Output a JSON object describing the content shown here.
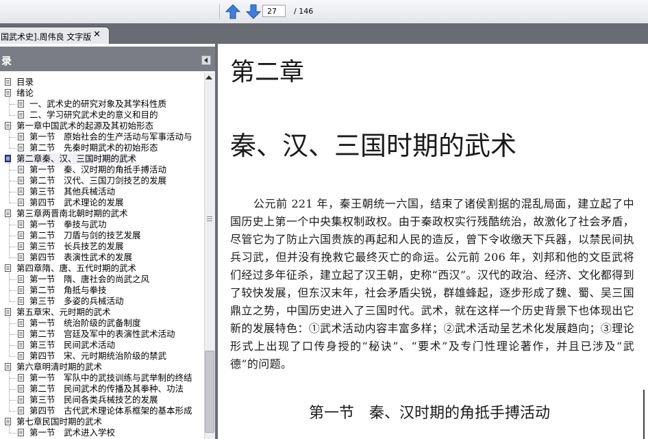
{
  "toolbar": {
    "prev_icon": "arrow-up-icon",
    "next_icon": "arrow-down-icon",
    "page_value": "27",
    "page_total": "/ 146"
  },
  "tab": {
    "label": "国武术史].周伟良 文字版",
    "close": "✕"
  },
  "sidebar": {
    "title": "录",
    "items": [
      {
        "label": "目录",
        "level": 0
      },
      {
        "label": "绪论",
        "level": 0
      },
      {
        "label": "一、武术史的研究对象及其学科性质",
        "level": 1
      },
      {
        "label": "二、学习研究武术史的意义和目的",
        "level": 1
      },
      {
        "label": "第一章中国武术的起源及其初始形态",
        "level": 0
      },
      {
        "label": "第一节　原始社会的生产活动与军事活动与",
        "level": 1
      },
      {
        "label": "第二节　先秦时期武术的初始形态",
        "level": 1
      },
      {
        "label": "第二章秦、汉、三国时期的武术",
        "level": 0,
        "active": true
      },
      {
        "label": "第一节　秦、汉时期的角抵手搏活动",
        "level": 1
      },
      {
        "label": "第二节　汉代、三国刀剑技艺的发展",
        "level": 1
      },
      {
        "label": "第三节　其他兵械活动",
        "level": 1
      },
      {
        "label": "第四节　武术理论的发展",
        "level": 1
      },
      {
        "label": "第三章两晋南北朝时期的武术",
        "level": 0
      },
      {
        "label": "第一节　拳技与武功",
        "level": 1
      },
      {
        "label": "第二节　刀盾与剑的技艺发展",
        "level": 1
      },
      {
        "label": "第三节　长兵技艺的发展",
        "level": 1
      },
      {
        "label": "第四节　表演性武术的发展",
        "level": 1
      },
      {
        "label": "第四章隋、唐、五代时期的武术",
        "level": 0
      },
      {
        "label": "第一节　隋、唐社会的尚武之风",
        "level": 1
      },
      {
        "label": "第二节　角抵与拳技",
        "level": 1
      },
      {
        "label": "第三节　多姿的兵械活动",
        "level": 1
      },
      {
        "label": "第五章宋、元时期的武术",
        "level": 0
      },
      {
        "label": "第一节　统治阶级的武备制度",
        "level": 1
      },
      {
        "label": "第二节　宫廷及军中的表演性武术活动",
        "level": 1
      },
      {
        "label": "第三节　民间武术活动",
        "level": 1
      },
      {
        "label": "第四节　宋、元时期统治阶级的禁武",
        "level": 1
      },
      {
        "label": "第六章明清时期的武术",
        "level": 0
      },
      {
        "label": "第一节　军队中的武技训练与武举制的终结",
        "level": 1
      },
      {
        "label": "第二节　民间武术的传播及其拳种、功法",
        "level": 1
      },
      {
        "label": "第三节　民间各类兵械技艺的发展",
        "level": 1
      },
      {
        "label": "第四节　古代武术理论体系框架的基本形成",
        "level": 1
      },
      {
        "label": "第七章民国时期的武术",
        "level": 0
      },
      {
        "label": "第一节　武术进入学校",
        "level": 1
      }
    ]
  },
  "document": {
    "chapter": "第二章",
    "chapter_title": "秦、汉、三国时期的武术",
    "paragraph": "公元前 221 年，秦王朝统一六国，结束了诸侯割据的混乱局面，建立起了中国历史上第一个中央集权制政权。由于秦政权实行残酷统治，故激化了社会矛盾，尽管它为了防止六国贵族的再起和人民的造反，曾下令收缴天下兵器，以禁民间执兵习武，但并没有挽救它最终灭亡的命运。公元前 206 年，刘邦和他的文臣武将们经过多年征杀，建立起了汉王朝，史称“西汉”。汉代的政治、经济、文化都得到了较快发展，但东汉末年，社会矛盾尖锐，群雄蜂起，逐步形成了魏、蜀、吴三国鼎立之势，中国历史进入了三国时代。武术，就在这样一个历史背景下也体现出它新的发展特色：①武术活动内容丰富多样；②武术活动呈艺术化发展趋向；③理论形式上出现了口传身授的“秘诀”、“要术”及专门性理论著作，并且已涉及“武德”的问题。",
    "section_title": "第一节　秦、汉时期的角抵手搏活动"
  },
  "colors": {
    "toolbar_bg": "#e3e5ea",
    "tabstrip_bg": "#6a6c74",
    "sidebar_header_bg": "#7a7d85",
    "nav_arrow": "#2f6fd6"
  }
}
